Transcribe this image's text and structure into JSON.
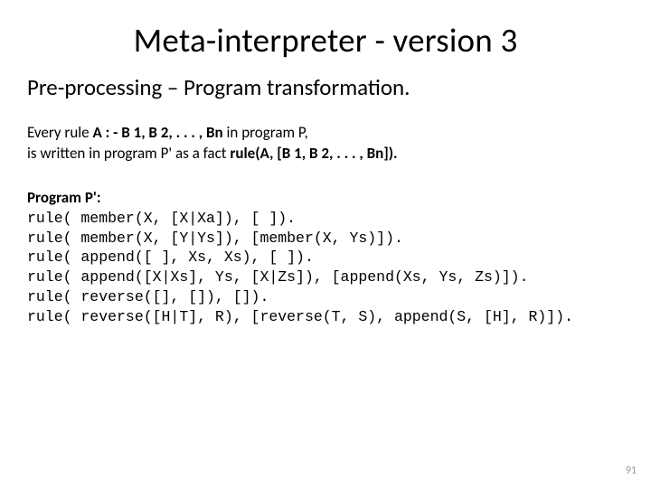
{
  "title": "Meta-interpreter - version 3",
  "subtitle": "Pre-processing – Program transformation.",
  "para": {
    "l1a": "Every rule ",
    "l1b": "A : - B 1, B 2, . . . , Bn ",
    "l1c": "in program P,",
    "l2a": "is written in program P' as a fact ",
    "l2b": "rule(A, [B 1, B 2, . . . , Bn])."
  },
  "program_label": "Program P':",
  "code": {
    "r1": "rule( member(X, [X|Xa]), [ ]).",
    "r2": "rule( member(X, [Y|Ys]), [member(X, Ys)]).",
    "r3": "rule( append([ ], Xs, Xs), [ ]).",
    "r4": "rule( append([X|Xs], Ys, [X|Zs]), [append(Xs, Ys, Zs)]).",
    "r5": "rule( reverse([], []), []).",
    "r6": "rule( reverse([H|T], R), [reverse(T, S), append(S, [H], R)])."
  },
  "page_number": "91"
}
